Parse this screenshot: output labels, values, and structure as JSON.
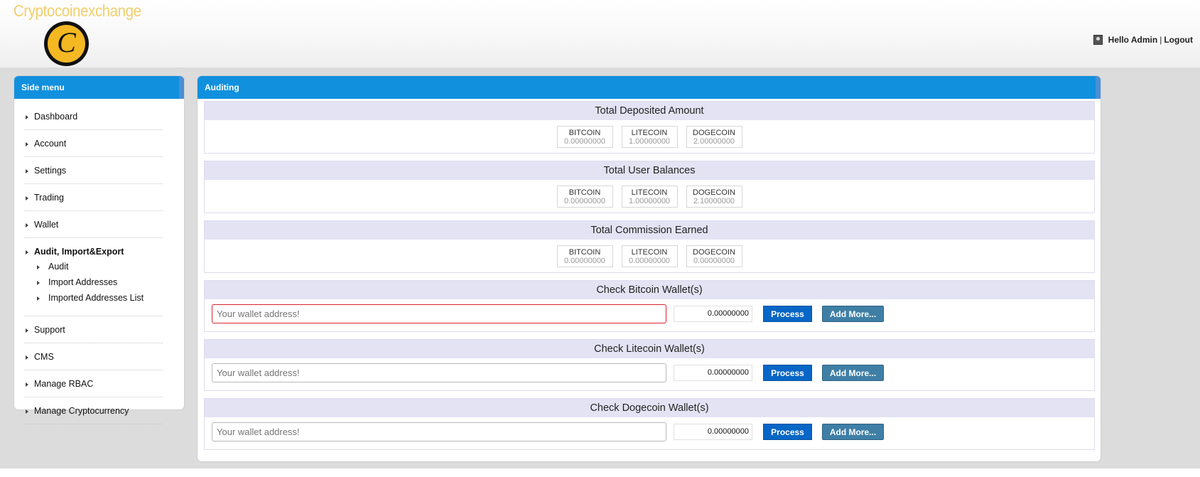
{
  "brand": {
    "name": "Cryptocoinexchange",
    "logo_letter": "C"
  },
  "user": {
    "greeting": "Hello Admin",
    "separator": "|",
    "logout": "Logout"
  },
  "sidebar": {
    "title": "Side menu",
    "items": [
      {
        "label": "Dashboard"
      },
      {
        "label": "Account"
      },
      {
        "label": "Settings"
      },
      {
        "label": "Trading"
      },
      {
        "label": "Wallet"
      },
      {
        "label": "Audit, Import&Export",
        "children": [
          "Audit",
          "Import Addresses",
          "Imported Addresses List"
        ]
      },
      {
        "label": "Support"
      },
      {
        "label": "CMS"
      },
      {
        "label": "Manage RBAC"
      },
      {
        "label": "Manage Cryptocurrency"
      }
    ]
  },
  "main": {
    "title": "Auditing",
    "totals": [
      {
        "title": "Total Deposited Amount",
        "coins": [
          {
            "name": "BITCOIN",
            "value": "0.00000000"
          },
          {
            "name": "LITECOIN",
            "value": "1.00000000"
          },
          {
            "name": "DOGECOIN",
            "value": "2.00000000"
          }
        ]
      },
      {
        "title": "Total User Balances",
        "coins": [
          {
            "name": "BITCOIN",
            "value": "0.00000000"
          },
          {
            "name": "LITECOIN",
            "value": "1.00000000"
          },
          {
            "name": "DOGECOIN",
            "value": "2.10000000"
          }
        ]
      },
      {
        "title": "Total Commission Earned",
        "coins": [
          {
            "name": "BITCOIN",
            "value": "0.00000000"
          },
          {
            "name": "LITECOIN",
            "value": "0.00000000"
          },
          {
            "name": "DOGECOIN",
            "value": "0.00000000"
          }
        ]
      }
    ],
    "wallet_checks": [
      {
        "title": "Check Bitcoin Wallet(s)",
        "placeholder": "Your wallet address!",
        "amount": "0.00000000",
        "process_label": "Process",
        "add_more_label": "Add More..."
      },
      {
        "title": "Check Litecoin Wallet(s)",
        "placeholder": "Your wallet address!",
        "amount": "0.00000000",
        "process_label": "Process",
        "add_more_label": "Add More..."
      },
      {
        "title": "Check Dogecoin Wallet(s)",
        "placeholder": "Your wallet address!",
        "amount": "0.00000000",
        "process_label": "Process",
        "add_more_label": "Add More..."
      }
    ]
  },
  "colors": {
    "header_blue": "#1190de",
    "process_button": "#0866c6",
    "add_more_button": "#3f7fa6",
    "error_border": "#d9232e",
    "brand_gold": "#f4b823"
  }
}
